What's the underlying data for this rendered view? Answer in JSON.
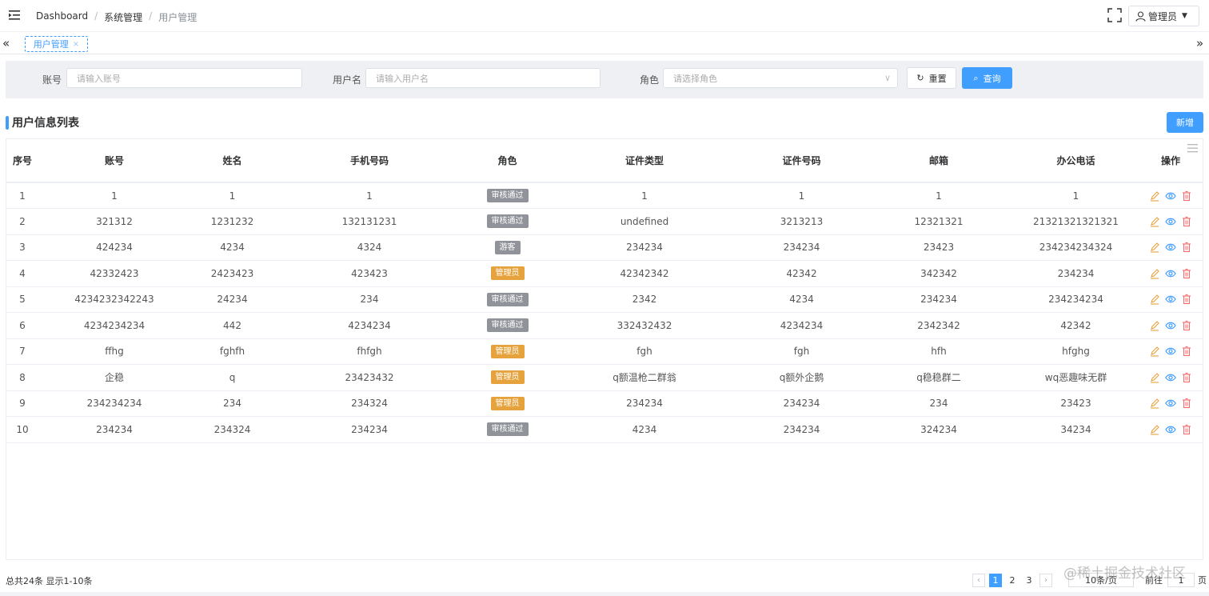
{
  "header": {
    "breadcrumb": [
      "Dashboard",
      "系统管理",
      "用户管理"
    ],
    "user_label": "管理员"
  },
  "tags": {
    "active_tag": "用户管理",
    "close_glyph": "×"
  },
  "search": {
    "account_label": "账号",
    "account_placeholder": "请输入账号",
    "username_label": "用户名",
    "username_placeholder": "请输入用户名",
    "role_label": "角色",
    "role_placeholder": "请选择角色",
    "reset_label": "重置",
    "query_label": "查询"
  },
  "list": {
    "title": "用户信息列表",
    "add_label": "新增"
  },
  "table": {
    "columns": [
      "序号",
      "账号",
      "姓名",
      "手机号码",
      "角色",
      "证件类型",
      "证件号码",
      "邮箱",
      "办公电话",
      "操作"
    ],
    "rows": [
      {
        "no": "1",
        "account": "1",
        "name": "1",
        "phone": "1",
        "role": "审核通过",
        "id_type": "1",
        "id_no": "1",
        "email": "1",
        "office": "1"
      },
      {
        "no": "2",
        "account": "321312",
        "name": "1231232",
        "phone": "132131231",
        "role": "审核通过",
        "id_type": "undefined",
        "id_no": "3213213",
        "email": "12321321",
        "office": "21321321321321"
      },
      {
        "no": "3",
        "account": "424234",
        "name": "4234",
        "phone": "4324",
        "role": "游客",
        "id_type": "234234",
        "id_no": "234234",
        "email": "23423",
        "office": "234234234324"
      },
      {
        "no": "4",
        "account": "42332423",
        "name": "2423423",
        "phone": "423423",
        "role": "管理员",
        "id_type": "42342342",
        "id_no": "42342",
        "email": "342342",
        "office": "234234"
      },
      {
        "no": "5",
        "account": "4234232342243",
        "name": "24234",
        "phone": "234",
        "role": "审核通过",
        "id_type": "2342",
        "id_no": "4234",
        "email": "234234",
        "office": "234234234"
      },
      {
        "no": "6",
        "account": "4234234234",
        "name": "442",
        "phone": "4234234",
        "role": "审核通过",
        "id_type": "332432432",
        "id_no": "4234234",
        "email": "2342342",
        "office": "42342"
      },
      {
        "no": "7",
        "account": "ffhg",
        "name": "fghfh",
        "phone": "fhfgh",
        "role": "管理员",
        "id_type": "fgh",
        "id_no": "fgh",
        "email": "hfh",
        "office": "hfghg"
      },
      {
        "no": "8",
        "account": "企稳",
        "name": "q",
        "phone": "23423432",
        "role": "管理员",
        "id_type": "q额温枪二群翁",
        "id_no": "q额外企鹅",
        "email": "q稳稳群二",
        "office": "wq恶趣味无群"
      },
      {
        "no": "9",
        "account": "234234234",
        "name": "234",
        "phone": "234324",
        "role": "管理员",
        "id_type": "234234",
        "id_no": "234234",
        "email": "234",
        "office": "23423"
      },
      {
        "no": "10",
        "account": "234234",
        "name": "234324",
        "phone": "234234",
        "role": "审核通过",
        "id_type": "4234",
        "id_no": "234234",
        "email": "324234",
        "office": "34234"
      }
    ],
    "role_colors": {
      "审核通过": "#909399",
      "游客": "#909399",
      "管理员": "#e6a23c"
    },
    "action_icons": [
      "edit-icon",
      "view-icon",
      "delete-icon"
    ],
    "action_colors": {
      "edit": "#e6a23c",
      "view": "#409eff",
      "delete": "#f56c6c"
    }
  },
  "pagination": {
    "summary": "总共24条 显示1-10条",
    "pages": [
      "1",
      "2",
      "3"
    ],
    "current_page": "1",
    "prev_glyph": "‹",
    "next_glyph": "›",
    "page_size": "10条/页",
    "goto_label": "前往",
    "goto_value": "1",
    "goto_suffix": "页"
  },
  "watermark": "@稀土掘金技术社区",
  "colors": {
    "primary": "#409eff",
    "warning": "#e6a23c",
    "danger": "#f56c6c",
    "info": "#909399"
  }
}
